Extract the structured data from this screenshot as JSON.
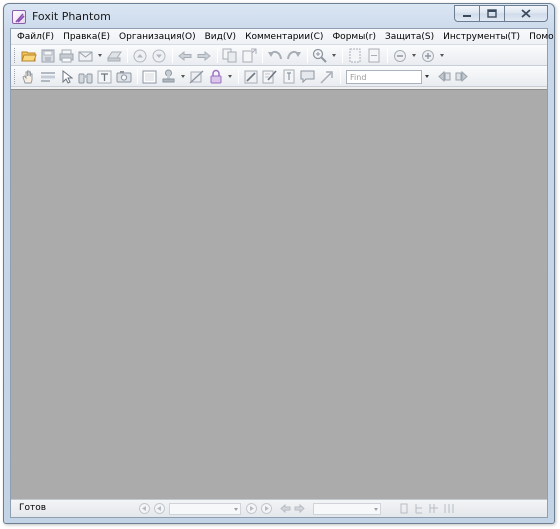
{
  "window": {
    "title": "Foxit Phantom"
  },
  "menu": [
    "Файл(F)",
    "Правка(E)",
    "Организация(O)",
    "Вид(V)",
    "Комментарии(C)",
    "Формы(r)",
    "Защита(S)",
    "Инструменты(T)",
    "Помощь(H)"
  ],
  "toolbar2": {
    "find_placeholder": "Find"
  },
  "status": {
    "text": "Готов"
  },
  "colors": {
    "document_background": "#ababab",
    "accent_open": "#e8b34a",
    "lock_accent": "#9b6fc0"
  }
}
